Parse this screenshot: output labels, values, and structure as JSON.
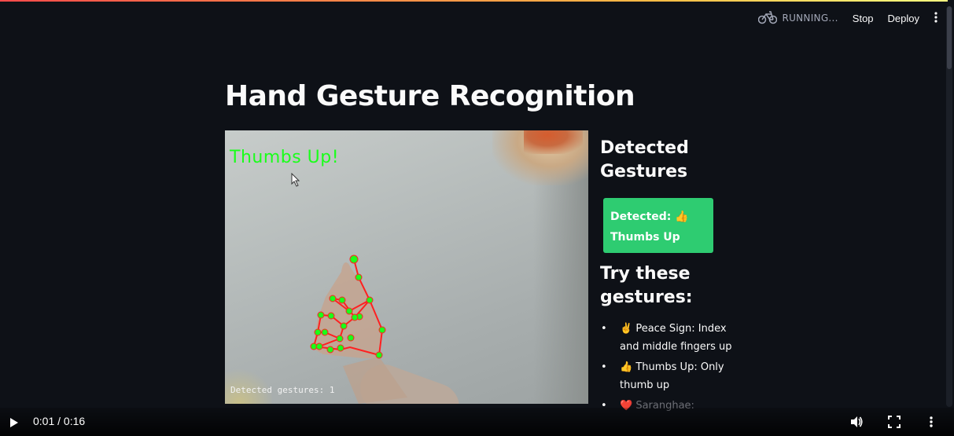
{
  "header": {
    "status": "RUNNING...",
    "stop_label": "Stop",
    "deploy_label": "Deploy",
    "status_icon": "bicycle-icon",
    "menu_icon": "kebab-menu-icon"
  },
  "main": {
    "title": "Hand Gesture Recognition"
  },
  "video_feed": {
    "overlay_label": "Thumbs Up!",
    "count_text": "Detected gestures: 1"
  },
  "sidebar": {
    "detected_heading": "Detected Gestures",
    "detected_line1": "Detected: 👍",
    "detected_line2": "Thumbs Up",
    "detected_color": "#2ecc71",
    "try_heading": "Try these gestures:",
    "gestures": [
      "✌️ Peace Sign: Index and middle fingers up",
      "👍 Thumbs Up: Only thumb up",
      "❤️ Saranghae:"
    ]
  },
  "player": {
    "time": "0:01 / 0:16",
    "icons": [
      "play-icon",
      "volume-icon",
      "fullscreen-icon",
      "more-options-icon"
    ]
  },
  "colors": {
    "background": "#0e1117",
    "overlay_green": "#1aff1a",
    "landmark_line": "#ff2020"
  }
}
